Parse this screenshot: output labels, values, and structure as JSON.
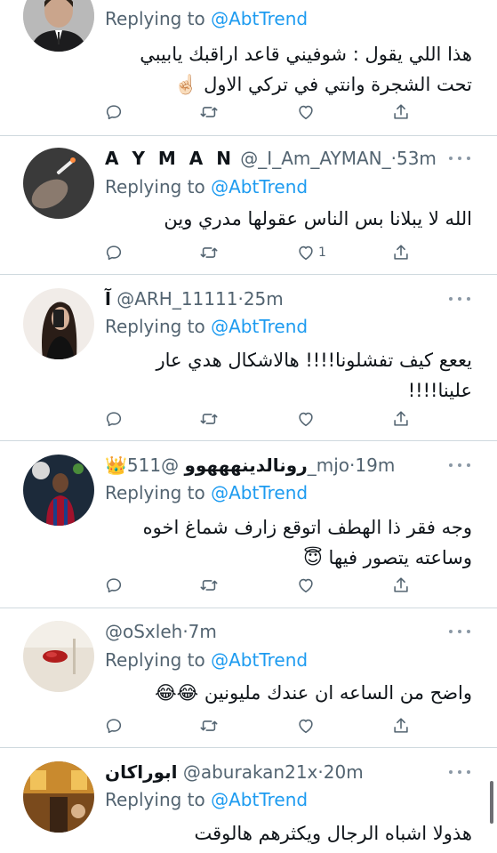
{
  "replying_prefix": "Replying to",
  "tweets": [
    {
      "display_name": "",
      "handle": "",
      "time": "",
      "mention": "@AbtTrend",
      "body": "هذا اللي يقول : شوفيني قاعد اراقبك يابيبي\nتحت الشجرة وانتي في تركي الاول ☝🏻",
      "like_count": "",
      "avatar_icon": "avatar-man-suit"
    },
    {
      "display_name": "A Y M A N",
      "handle": "@_I_Am_AYMAN_",
      "time": "53m",
      "mention": "@AbtTrend",
      "body": "الله لا يبلانا بس الناس عقولها مدري وين",
      "like_count": "1",
      "avatar_icon": "avatar-hand-cigarette"
    },
    {
      "display_name": "آ",
      "handle": "@ARH_11111",
      "time": "25m",
      "mention": "@AbtTrend",
      "body": "يععع كيف تفشلونا!!!! هالاشكال هدي عار\nعلينا!!!!",
      "like_count": "",
      "avatar_icon": "avatar-woman-mirror"
    },
    {
      "display_name": "رونالدينهههوو",
      "display_prefix": "👑",
      "handle": "@511_mjo",
      "time": "19m",
      "mention": "@AbtTrend",
      "body": "وجه فقر ذا الهطف اتوقع زارف شماغ اخوه\nوساعته يتصور فيها 😇",
      "like_count": "",
      "avatar_icon": "avatar-footballer"
    },
    {
      "display_name": "",
      "handle": "@oSxleh",
      "time": "7m",
      "mention": "@AbtTrend",
      "body": "واضح من الساعه ان عندك مليونين 😂😂",
      "like_count": "",
      "avatar_icon": "avatar-red-object"
    },
    {
      "display_name": "ابوراكان",
      "handle": "@aburakan21x",
      "time": "20m",
      "mention": "@AbtTrend",
      "body": "هذولا اشباه الرجال ويكثرهم هالوقت",
      "like_count": "",
      "avatar_icon": "avatar-golden-room"
    }
  ],
  "action_icons": [
    "reply-icon",
    "retweet-icon",
    "like-icon",
    "share-icon"
  ],
  "colors": {
    "accent": "#1d9bf0",
    "secondary_text": "#536471",
    "divider": "#cfd9de"
  }
}
